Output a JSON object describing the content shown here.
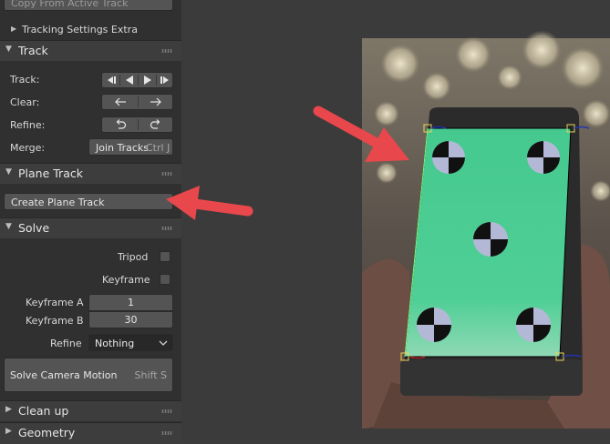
{
  "top_button": {
    "label": "Copy From Active Track"
  },
  "tracking_settings_extra": {
    "label": "Tracking Settings Extra"
  },
  "track_panel": {
    "title": "Track",
    "track_label": "Track:",
    "clear_label": "Clear:",
    "refine_label": "Refine:",
    "merge_label": "Merge:",
    "join_tracks_label": "Join Tracks",
    "join_tracks_shortcut": "Ctrl J"
  },
  "plane_track_panel": {
    "title": "Plane Track",
    "create_button": "Create Plane Track"
  },
  "solve_panel": {
    "title": "Solve",
    "tripod_label": "Tripod",
    "keyframe_label": "Keyframe",
    "keyframe_a_label": "Keyframe A",
    "keyframe_a_value": "1",
    "keyframe_b_label": "Keyframe B",
    "keyframe_b_value": "30",
    "refine_label": "Refine",
    "refine_value": "Nothing",
    "solve_button": "Solve Camera Motion",
    "solve_shortcut": "Shift S"
  },
  "cleanup_panel": {
    "title": "Clean up"
  },
  "geometry_panel": {
    "title": "Geometry"
  },
  "colors": {
    "annotation_arrow": "#e8474c",
    "plane_fill": "#4ecf95",
    "panel_bg": "#303030"
  }
}
